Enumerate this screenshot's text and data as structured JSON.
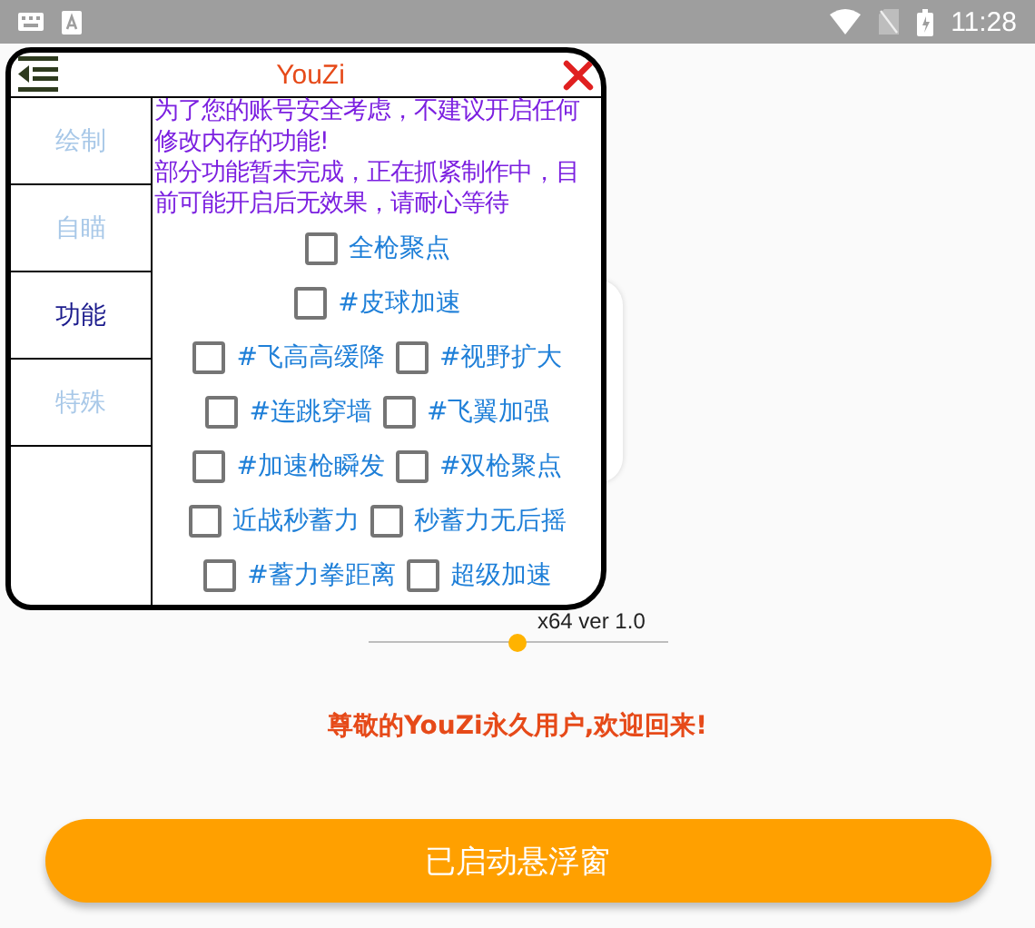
{
  "status_bar": {
    "time": "11:28"
  },
  "panel": {
    "title": "YouZi",
    "tabs": [
      {
        "label": "绘制",
        "selected": false
      },
      {
        "label": "自瞄",
        "selected": false
      },
      {
        "label": "功能",
        "selected": true
      },
      {
        "label": "特殊",
        "selected": false
      }
    ],
    "notices": [
      "为了您的账号安全考虑，不建议开启任何修改内存的功能!",
      "部分功能暂未完成，正在抓紧制作中，目前可能开启后无效果，请耐心等待"
    ],
    "option_rows": [
      [
        {
          "label": "全枪聚点",
          "checked": false
        }
      ],
      [
        {
          "label": "#皮球加速",
          "checked": false
        }
      ],
      [
        {
          "label": "#飞高高缓降",
          "checked": false
        },
        {
          "label": "#视野扩大",
          "checked": false
        }
      ],
      [
        {
          "label": "#连跳穿墙",
          "checked": false
        },
        {
          "label": "#飞翼加强",
          "checked": false
        }
      ],
      [
        {
          "label": "#加速枪瞬发",
          "checked": false
        },
        {
          "label": "#双枪聚点",
          "checked": false
        }
      ],
      [
        {
          "label": "近战秒蓄力",
          "checked": false
        },
        {
          "label": "秒蓄力无后摇",
          "checked": false
        }
      ],
      [
        {
          "label": "#蓄力拳距离",
          "checked": false
        },
        {
          "label": "超级加速",
          "checked": false
        }
      ]
    ]
  },
  "home": {
    "version": "x64 ver 1.0",
    "slider": {
      "level": 0.5
    },
    "greeting": "尊敬的YouZi永久用户,欢迎回来!",
    "button": "已启动悬浮窗"
  }
}
